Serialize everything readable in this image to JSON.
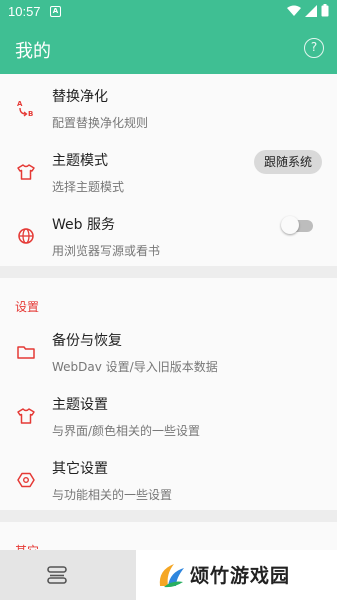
{
  "status_bar": {
    "time": "10:57",
    "notification_glyph": "A"
  },
  "app_bar": {
    "title": "我的",
    "help_glyph": "?"
  },
  "items": [
    {
      "title": "替换净化",
      "summary": "配置替换净化规则",
      "icon": "replace-icon"
    },
    {
      "title": "主题模式",
      "summary": "选择主题模式",
      "icon": "tshirt-icon",
      "value": "跟随系统"
    },
    {
      "title": "Web 服务",
      "summary": "用浏览器写源或看书",
      "icon": "globe-icon",
      "toggle": false
    }
  ],
  "settings_section": {
    "header": "设置",
    "items": [
      {
        "title": "备份与恢复",
        "summary": "WebDav 设置/导入旧版本数据",
        "icon": "folder-icon"
      },
      {
        "title": "主题设置",
        "summary": "与界面/颜色相关的一些设置",
        "icon": "tshirt-icon"
      },
      {
        "title": "其它设置",
        "summary": "与功能相关的一些设置",
        "icon": "hexagon-gear-icon"
      }
    ]
  },
  "other_section": {
    "header": "其它"
  },
  "watermark": {
    "text": "颂竹游戏园"
  },
  "colors": {
    "primary": "#3fbf93",
    "accent": "#e53935",
    "background": "#f2f2f2"
  }
}
